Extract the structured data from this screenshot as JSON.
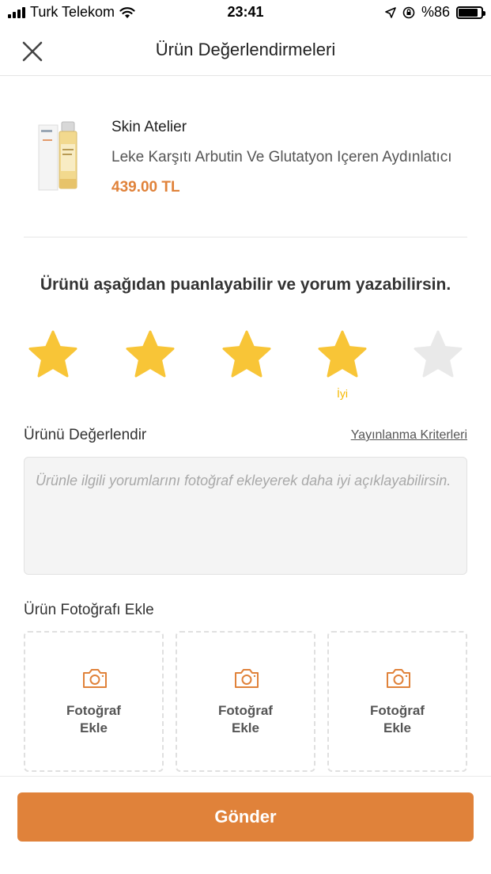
{
  "status_bar": {
    "carrier": "Turk Telekom",
    "time": "23:41",
    "battery": "%86",
    "battery_level": 0.86
  },
  "header": {
    "title": "Ürün Değerlendirmeleri"
  },
  "product": {
    "brand": "Skin Atelier",
    "name": "Leke Karşıtı Arbutin Ve Glutatyon Içeren Aydınlatıcı",
    "price": "439.00 TL"
  },
  "prompt": "Ürünü aşağıdan puanlayabilir ve yorum yazabilirsin.",
  "rating": {
    "value": 4,
    "max": 5,
    "label": "İyi",
    "filled_color": "#f8c537",
    "empty_color": "#e9e9e9"
  },
  "review": {
    "title": "Ürünü Değerlendir",
    "criteria_link": "Yayınlanma Kriterleri",
    "placeholder": "Ürünle ilgili yorumlarını fotoğraf ekleyerek daha iyi açıklayabilirsin."
  },
  "photos": {
    "title": "Ürün Fotoğrafı Ekle",
    "slots": [
      {
        "line1": "Fotoğraf",
        "line2": "Ekle"
      },
      {
        "line1": "Fotoğraf",
        "line2": "Ekle"
      },
      {
        "line1": "Fotoğraf",
        "line2": "Ekle"
      }
    ]
  },
  "submit": {
    "label": "Gönder"
  },
  "colors": {
    "accent": "#e0823a",
    "star": "#f8c537"
  }
}
